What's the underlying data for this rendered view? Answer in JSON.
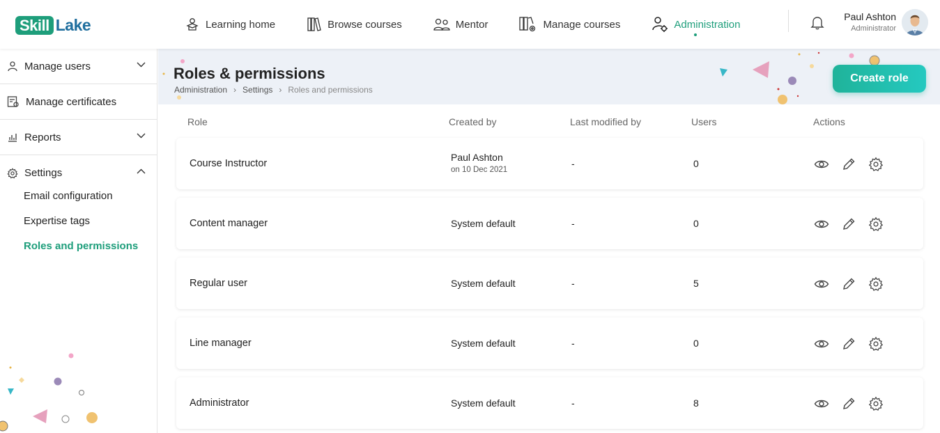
{
  "brand": {
    "logo_part1": "Skill",
    "logo_part2": "Lake",
    "accent": "#1e9e7b"
  },
  "nav": {
    "items": [
      {
        "label": "Learning home",
        "icon": "learner-icon"
      },
      {
        "label": "Browse courses",
        "icon": "books-icon"
      },
      {
        "label": "Mentor",
        "icon": "mentor-icon"
      },
      {
        "label": "Manage courses",
        "icon": "manage-courses-icon"
      },
      {
        "label": "Administration",
        "icon": "admin-icon",
        "active": true
      }
    ]
  },
  "user": {
    "name": "Paul Ashton",
    "role": "Administrator"
  },
  "sidebar": {
    "items": [
      {
        "label": "Manage users",
        "icon": "user-icon"
      },
      {
        "label": "Manage certificates",
        "icon": "certificate-icon"
      },
      {
        "label": "Reports",
        "icon": "reports-icon"
      },
      {
        "label": "Settings",
        "icon": "gear-icon"
      }
    ],
    "settings_sub": [
      {
        "label": "Email configuration"
      },
      {
        "label": "Expertise tags"
      },
      {
        "label": "Roles and permissions",
        "active": true
      }
    ]
  },
  "page": {
    "title": "Roles & permissions",
    "breadcrumb": [
      "Administration",
      "Settings",
      "Roles and permissions"
    ],
    "create_button": "Create role"
  },
  "table": {
    "headers": {
      "role": "Role",
      "created_by": "Created by",
      "last_modified_by": "Last modified by",
      "users": "Users",
      "actions": "Actions"
    },
    "rows": [
      {
        "role": "Course Instructor",
        "created_by": "Paul Ashton",
        "created_on": "on 10 Dec 2021",
        "last_modified_by": "-",
        "users": "0"
      },
      {
        "role": "Content manager",
        "created_by": "System default",
        "last_modified_by": "-",
        "users": "0"
      },
      {
        "role": "Regular user",
        "created_by": "System default",
        "last_modified_by": "-",
        "users": "5"
      },
      {
        "role": "Line manager",
        "created_by": "System default",
        "last_modified_by": "-",
        "users": "0"
      },
      {
        "role": "Administrator",
        "created_by": "System default",
        "last_modified_by": "-",
        "users": "8"
      }
    ],
    "action_icons": [
      "eye-icon",
      "pencil-icon",
      "gear-icon"
    ]
  }
}
